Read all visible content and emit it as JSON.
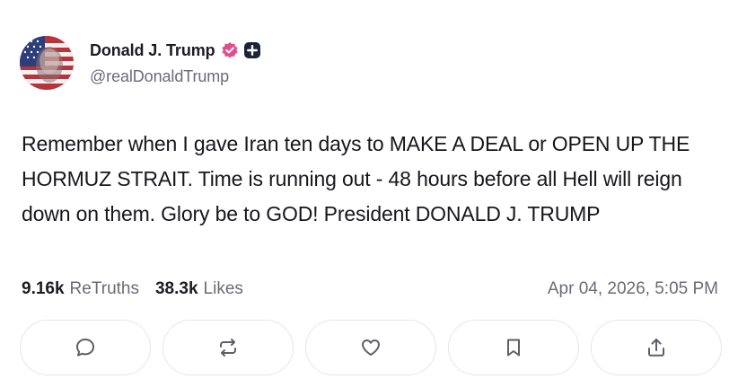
{
  "author": {
    "display_name": "Donald J. Trump",
    "handle": "@realDonaldTrump",
    "verified_icon": "verified-check-badge-icon",
    "plus_icon": "plus-badge-icon",
    "verified_color": "#e24e8b"
  },
  "post": {
    "text": "Remember when I gave Iran ten days to MAKE A DEAL or OPEN UP THE HORMUZ STRAIT. Time is running out - 48 hours before all Hell will reign down on them. Glory be to GOD! President DONALD J. TRUMP"
  },
  "stats": {
    "retruths_count": "9.16k",
    "retruths_label": "ReTruths",
    "likes_count": "38.3k",
    "likes_label": "Likes",
    "timestamp": "Apr 04, 2026, 5:05 PM"
  },
  "actions": [
    {
      "name": "reply",
      "icon": "comment-bubble-icon"
    },
    {
      "name": "retruth",
      "icon": "repost-arrows-icon"
    },
    {
      "name": "like",
      "icon": "heart-icon"
    },
    {
      "name": "bookmark",
      "icon": "bookmark-icon"
    },
    {
      "name": "share",
      "icon": "share-upload-icon"
    }
  ],
  "colors": {
    "text": "#1c1c22",
    "muted": "#6b6b78",
    "border": "#e6e6ea",
    "icon": "#5e5e6a"
  }
}
